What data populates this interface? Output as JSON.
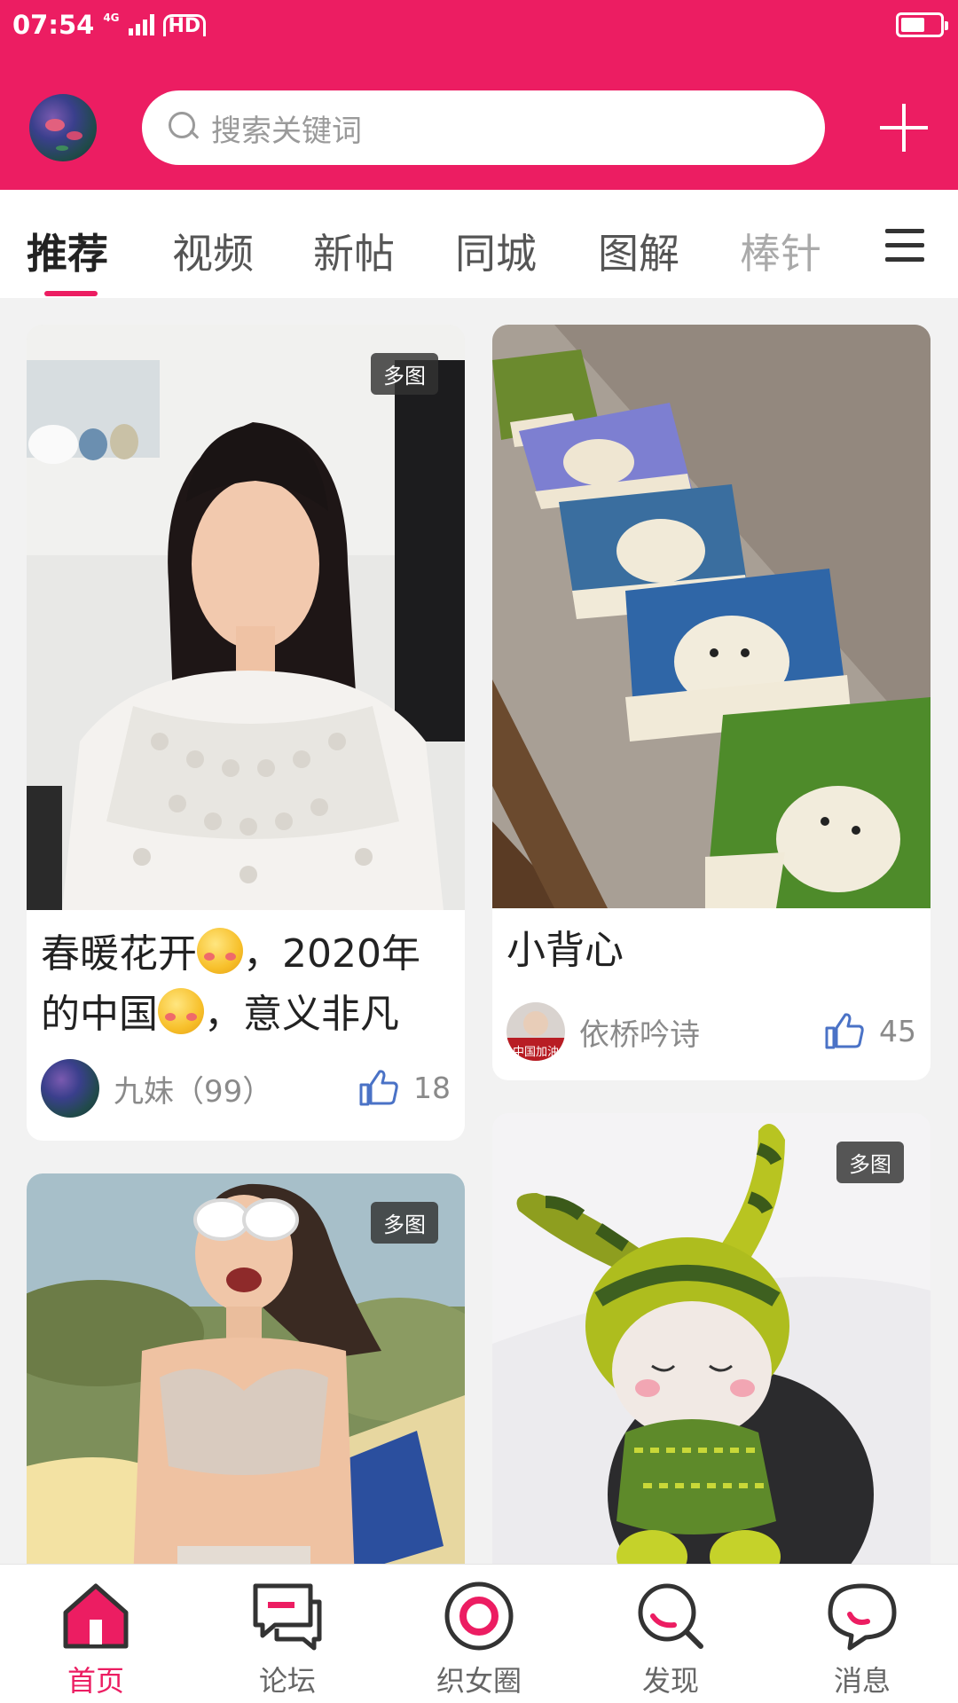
{
  "status_bar": {
    "time": "07:54",
    "network": "4G",
    "hd": "HD",
    "battery_level": 0.5
  },
  "header": {
    "search_placeholder": "搜索关键词",
    "accent_color": "#ec1d62"
  },
  "tabs": [
    {
      "label": "推荐",
      "active": true
    },
    {
      "label": "视频",
      "active": false
    },
    {
      "label": "新帖",
      "active": false
    },
    {
      "label": "同城",
      "active": false
    },
    {
      "label": "图解",
      "active": false
    },
    {
      "label": "棒针",
      "active": false
    }
  ],
  "feed": {
    "cards": [
      {
        "badge": "多图",
        "title_part1": "春暖花开",
        "title_part2": "，2020年",
        "title_part3": "的中国",
        "title_part4": "，意义非凡",
        "author": "九妹（99）",
        "likes": "18"
      },
      {
        "title": "小背心",
        "author": "依桥吟诗",
        "author_avatar_text": "中国加油",
        "likes": "45"
      },
      {
        "badge": "多图"
      },
      {
        "badge": "多图"
      }
    ]
  },
  "bottom_nav": [
    {
      "label": "首页",
      "icon": "home-icon",
      "active": true
    },
    {
      "label": "论坛",
      "icon": "forum-icon",
      "active": false
    },
    {
      "label": "织女圈",
      "icon": "circle-icon",
      "active": false
    },
    {
      "label": "发现",
      "icon": "discover-icon",
      "active": false
    },
    {
      "label": "消息",
      "icon": "message-icon",
      "active": false
    }
  ]
}
